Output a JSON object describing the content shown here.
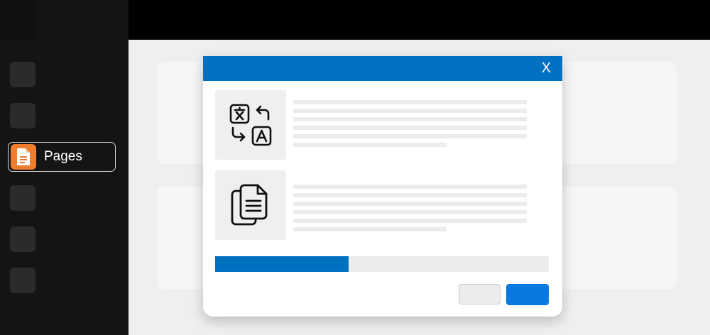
{
  "sidebar": {
    "active_item": {
      "label": "Pages",
      "icon": "document-icon",
      "icon_color": "#ef7d2e"
    }
  },
  "dialog": {
    "close_label": "X",
    "header_color": "#0270c1",
    "items": [
      {
        "icon": "translate-icon"
      },
      {
        "icon": "copy-documents-icon"
      }
    ],
    "progress": {
      "fraction": 0.4,
      "color": "#0270c1"
    }
  }
}
